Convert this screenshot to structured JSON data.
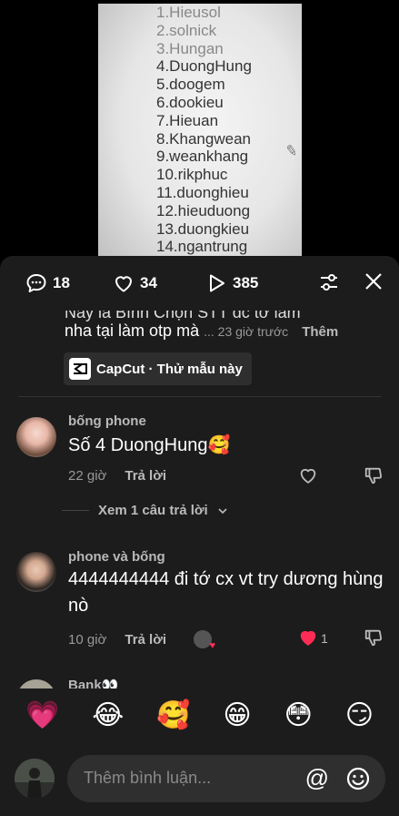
{
  "video": {
    "list_items": [
      "1.Hieusol",
      "2.solnick",
      "3.Hungan",
      "4.DuongHung",
      "5.doogem",
      "6.dookieu",
      "7.Hieuan",
      "8.Khangwean",
      "9.weankhang",
      "10.rikphuc",
      "11.duonghieu",
      "12.hieuduong",
      "13.duongkieu",
      "14.ngantrung"
    ]
  },
  "header": {
    "comments_count": "18",
    "likes_count": "34",
    "shares_count": "385"
  },
  "prev_comment": {
    "line1": "Này là Bình Chọn STT dc tớ làm",
    "line2": "nha tại làm otp mà",
    "time": "... 23 giờ trước",
    "more_label": "Thêm",
    "capcut_label": "CapCut · Thử mẫu này"
  },
  "comments": [
    {
      "username": "bống phone",
      "text": "Số 4 DuongHung🥰",
      "time": "22 giờ",
      "reply_label": "Trả lời",
      "view_replies": "Xem 1 câu trả lời"
    },
    {
      "username": "phone và bống",
      "text": "4444444444 đi tớ cx vt try dương hùng nò",
      "time": "10 giờ",
      "reply_label": "Trả lời",
      "likes": "1"
    },
    {
      "username": "Bank👀"
    }
  ],
  "emoji_bar": [
    "💗",
    "😂",
    "🥰",
    "😁",
    "😳",
    "😏"
  ],
  "input": {
    "placeholder": "Thêm bình luận...",
    "at_label": "@"
  },
  "colors": {
    "sheet_bg": "#1c1c1c",
    "liked_heart": "#fe2c55"
  }
}
